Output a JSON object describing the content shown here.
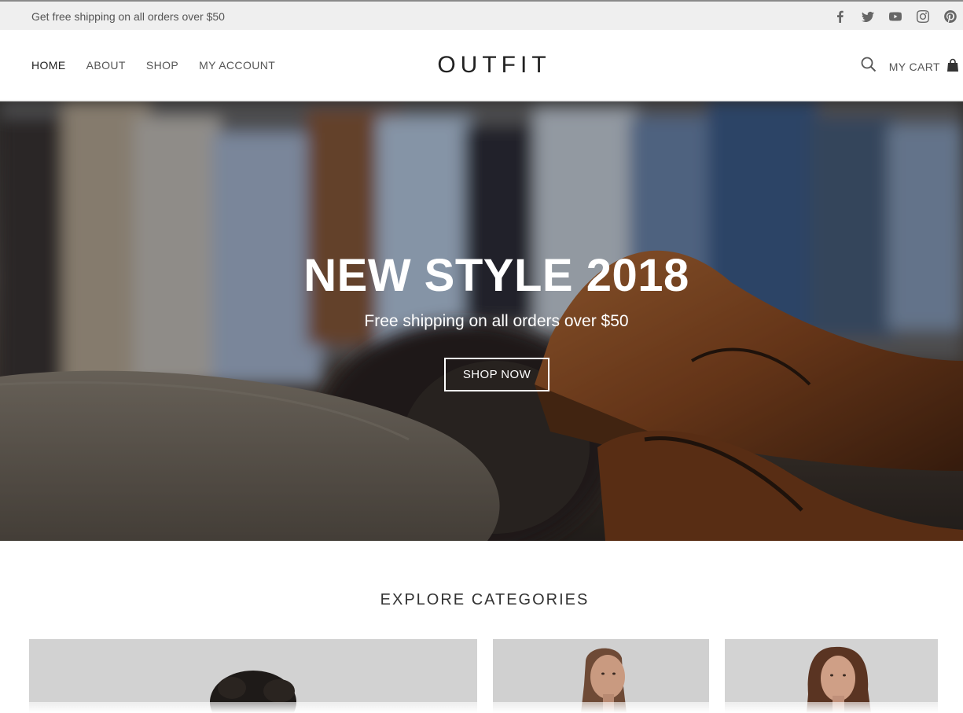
{
  "topbar": {
    "text": "Get free shipping on all orders over $50",
    "social_icons": [
      "facebook-icon",
      "twitter-icon",
      "youtube-icon",
      "instagram-icon",
      "pinterest-icon"
    ]
  },
  "header": {
    "nav": [
      {
        "label": "HOME",
        "active": true
      },
      {
        "label": "ABOUT",
        "active": false
      },
      {
        "label": "SHOP",
        "active": false
      },
      {
        "label": "MY ACCOUNT",
        "active": false
      }
    ],
    "logo": "OUTFIT",
    "cart_label": "MY CART"
  },
  "hero": {
    "title": "NEW STYLE 2018",
    "subtitle": "Free shipping on all orders over $50",
    "button_label": "SHOP NOW"
  },
  "categories": {
    "title": "EXPLORE CATEGORIES"
  },
  "colors": {
    "topbar_bg": "#efefef",
    "text_dark": "#222222",
    "text_muted": "#555555"
  }
}
